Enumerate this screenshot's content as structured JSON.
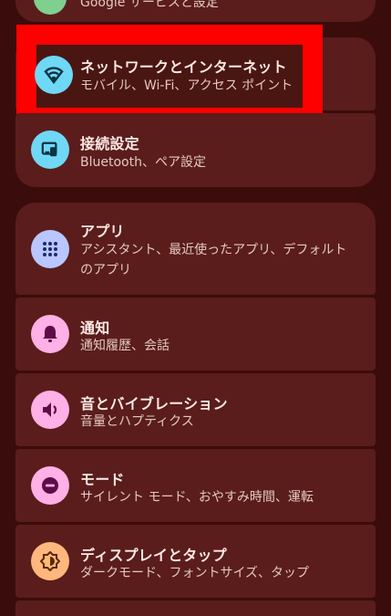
{
  "top_partial": {
    "subtitle": "Google サービスと設定"
  },
  "settings": [
    {
      "id": "network",
      "title": "ネットワークとインターネット",
      "subtitle": "モバイル、Wi-Fi、アクセス ポイント",
      "icon": "wifi-icon",
      "icon_bg": "#6fd8f5"
    },
    {
      "id": "connected",
      "title": "接続設定",
      "subtitle": "Bluetooth、ペア設定",
      "icon": "devices-icon",
      "icon_bg": "#6fd8f5"
    },
    {
      "id": "apps",
      "title": "アプリ",
      "subtitle_line1": "アシスタント、最近使ったアプリ、デフォルト",
      "subtitle_line2": "のアプリ",
      "icon": "apps-grid-icon",
      "icon_bg": "#b9c6ff"
    },
    {
      "id": "notifications",
      "title": "通知",
      "subtitle": "通知履歴、会話",
      "icon": "bell-icon",
      "icon_bg": "#ffb0e6"
    },
    {
      "id": "sound",
      "title": "音とバイブレーション",
      "subtitle": "音量とハプティクス",
      "icon": "volume-icon",
      "icon_bg": "#ffb0e6"
    },
    {
      "id": "modes",
      "title": "モード",
      "subtitle": "サイレント モード、おやすみ時間、運転",
      "icon": "do-not-disturb-icon",
      "icon_bg": "#ffb0e6"
    },
    {
      "id": "display",
      "title": "ディスプレイとタップ",
      "subtitle": "ダークモード、フォントサイズ、タップ",
      "icon": "brightness-icon",
      "icon_bg": "#ffb77d"
    }
  ],
  "colors": {
    "background": "#3b0c0c",
    "card": "#5a1d1b",
    "highlight": "#ff0000"
  }
}
